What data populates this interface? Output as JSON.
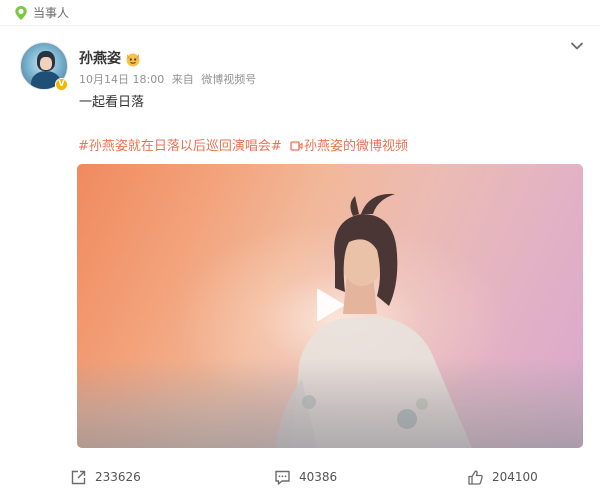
{
  "topbar": {
    "label": "当事人",
    "icon": "location-pin-icon",
    "icon_color": "#7ac943"
  },
  "post": {
    "username": "孙燕姿",
    "badge_icon": "emoji-medal-icon",
    "verified_icon": "verified-v-icon",
    "verified_color": "#f6b500",
    "date": "10月14日 18:00",
    "source_prefix": "来自",
    "source": "微博视频号",
    "text": "一起看日落",
    "hashtag": "#孙燕姿就在日落以后巡回演唱会#",
    "video_link": "孙燕姿的微博视频",
    "link_color": "#eb7350"
  },
  "video": {
    "play_icon": "play-icon"
  },
  "actions": {
    "reposts": "233626",
    "comments": "40386",
    "likes": "204100"
  }
}
